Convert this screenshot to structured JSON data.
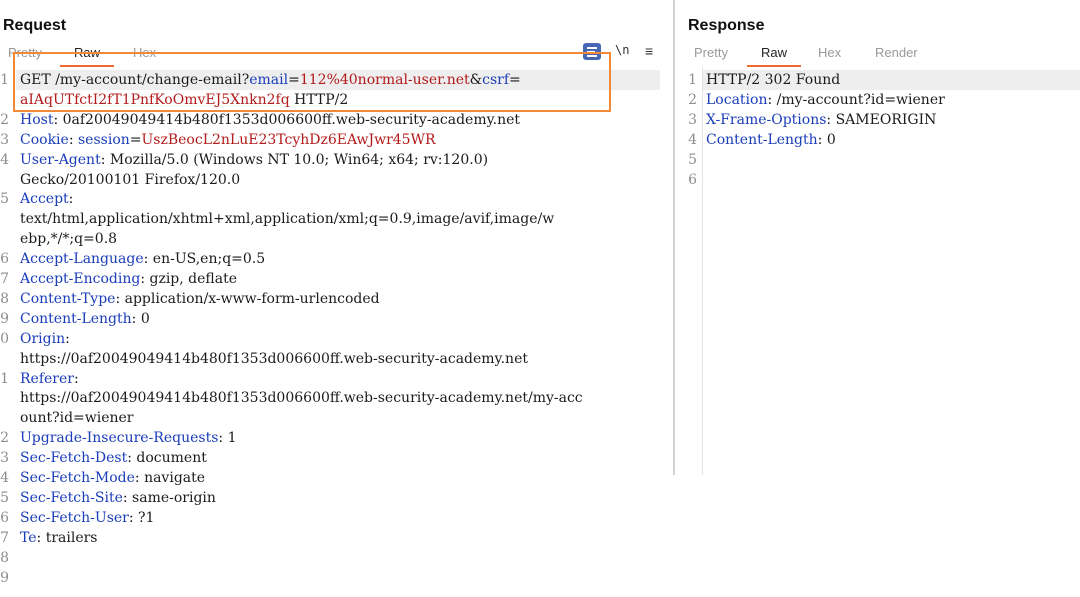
{
  "request": {
    "title": "Request",
    "tabs": [
      "Pretty",
      "Raw",
      "Hex"
    ],
    "active_tab": "Raw",
    "tools": {
      "wrap_icon": "wrap-lines-icon",
      "newline_label": "\\n",
      "menu_icon": "hamburger-menu-icon"
    },
    "lines": [
      {
        "num": "1",
        "segments": [
          {
            "t": "GET /my-account/change-email?",
            "c": "v"
          },
          {
            "t": "email",
            "c": "k"
          },
          {
            "t": "=",
            "c": "v"
          },
          {
            "t": "112%40normal-user.net",
            "c": "r"
          },
          {
            "t": "&",
            "c": "v"
          },
          {
            "t": "csrf",
            "c": "k"
          },
          {
            "t": "=",
            "c": "v"
          }
        ]
      },
      {
        "num": "",
        "segments": [
          {
            "t": "aIAqUTfctI2fT1PnfKoOmvEJ5Xnkn2fq",
            "c": "r"
          },
          {
            "t": " HTTP/2",
            "c": "v"
          }
        ]
      },
      {
        "num": "2",
        "segments": [
          {
            "t": "Host",
            "c": "k"
          },
          {
            "t": ": 0af20049049414b480f1353d006600ff.web-security-academy.net",
            "c": "v"
          }
        ]
      },
      {
        "num": "3",
        "segments": [
          {
            "t": "Cookie",
            "c": "k"
          },
          {
            "t": ": ",
            "c": "v"
          },
          {
            "t": "session",
            "c": "k"
          },
          {
            "t": "=",
            "c": "v"
          },
          {
            "t": "UszBeocL2nLuE23TcyhDz6EAwJwr45WR",
            "c": "r"
          }
        ]
      },
      {
        "num": "4",
        "segments": [
          {
            "t": "User-Agent",
            "c": "k"
          },
          {
            "t": ": Mozilla/5.0 (Windows NT 10.0; Win64; x64; rv:120.0)",
            "c": "v"
          }
        ]
      },
      {
        "num": "",
        "segments": [
          {
            "t": "Gecko/20100101 Firefox/120.0",
            "c": "v"
          }
        ]
      },
      {
        "num": "5",
        "segments": [
          {
            "t": "Accept",
            "c": "k"
          },
          {
            "t": ":",
            "c": "v"
          }
        ]
      },
      {
        "num": "",
        "segments": [
          {
            "t": "text/html,application/xhtml+xml,application/xml;q=0.9,image/avif,image/w",
            "c": "v"
          }
        ]
      },
      {
        "num": "",
        "segments": [
          {
            "t": "ebp,*/*;q=0.8",
            "c": "v"
          }
        ]
      },
      {
        "num": "6",
        "segments": [
          {
            "t": "Accept-Language",
            "c": "k"
          },
          {
            "t": ": en-US,en;q=0.5",
            "c": "v"
          }
        ]
      },
      {
        "num": "7",
        "segments": [
          {
            "t": "Accept-Encoding",
            "c": "k"
          },
          {
            "t": ": gzip, deflate",
            "c": "v"
          }
        ]
      },
      {
        "num": "8",
        "segments": [
          {
            "t": "Content-Type",
            "c": "k"
          },
          {
            "t": ": application/x-www-form-urlencoded",
            "c": "v"
          }
        ]
      },
      {
        "num": "9",
        "segments": [
          {
            "t": "Content-Length",
            "c": "k"
          },
          {
            "t": ": 0",
            "c": "v"
          }
        ]
      },
      {
        "num": "0",
        "segments": [
          {
            "t": "Origin",
            "c": "k"
          },
          {
            "t": ":",
            "c": "v"
          }
        ]
      },
      {
        "num": "",
        "segments": [
          {
            "t": "https://0af20049049414b480f1353d006600ff.web-security-academy.net",
            "c": "v"
          }
        ]
      },
      {
        "num": "1",
        "segments": [
          {
            "t": "Referer",
            "c": "k"
          },
          {
            "t": ":",
            "c": "v"
          }
        ]
      },
      {
        "num": "",
        "segments": [
          {
            "t": "https://0af20049049414b480f1353d006600ff.web-security-academy.net/my-acc",
            "c": "v"
          }
        ]
      },
      {
        "num": "",
        "segments": [
          {
            "t": "ount?id=wiener",
            "c": "v"
          }
        ]
      },
      {
        "num": "2",
        "segments": [
          {
            "t": "Upgrade-Insecure-Requests",
            "c": "k"
          },
          {
            "t": ": 1",
            "c": "v"
          }
        ]
      },
      {
        "num": "3",
        "segments": [
          {
            "t": "Sec-Fetch-Dest",
            "c": "k"
          },
          {
            "t": ": document",
            "c": "v"
          }
        ]
      },
      {
        "num": "4",
        "segments": [
          {
            "t": "Sec-Fetch-Mode",
            "c": "k"
          },
          {
            "t": ": navigate",
            "c": "v"
          }
        ]
      },
      {
        "num": "5",
        "segments": [
          {
            "t": "Sec-Fetch-Site",
            "c": "k"
          },
          {
            "t": ": same-origin",
            "c": "v"
          }
        ]
      },
      {
        "num": "6",
        "segments": [
          {
            "t": "Sec-Fetch-User",
            "c": "k"
          },
          {
            "t": ": ?1",
            "c": "v"
          }
        ]
      },
      {
        "num": "7",
        "segments": [
          {
            "t": "Te",
            "c": "k"
          },
          {
            "t": ": trailers",
            "c": "v"
          }
        ]
      },
      {
        "num": "8",
        "segments": []
      },
      {
        "num": "9",
        "segments": []
      }
    ]
  },
  "response": {
    "title": "Response",
    "tabs": [
      "Pretty",
      "Raw",
      "Hex",
      "Render"
    ],
    "active_tab": "Raw",
    "lines": [
      {
        "num": "1",
        "segments": [
          {
            "t": "HTTP/2 302 Found",
            "c": "v"
          }
        ]
      },
      {
        "num": "2",
        "segments": [
          {
            "t": "Location",
            "c": "k"
          },
          {
            "t": ": /my-account?id=wiener",
            "c": "v"
          }
        ]
      },
      {
        "num": "3",
        "segments": [
          {
            "t": "X-Frame-Options",
            "c": "k"
          },
          {
            "t": ": SAMEORIGIN",
            "c": "v"
          }
        ]
      },
      {
        "num": "4",
        "segments": [
          {
            "t": "Content-Length",
            "c": "k"
          },
          {
            "t": ": 0",
            "c": "v"
          }
        ]
      },
      {
        "num": "5",
        "segments": []
      },
      {
        "num": "6",
        "segments": []
      }
    ]
  },
  "colors": {
    "accent": "#ee6b2d",
    "highlight_box": "#f08a38",
    "header_key": "#1a3dba",
    "value_red": "#b31b1b",
    "wrap_button": "#4766b4"
  }
}
